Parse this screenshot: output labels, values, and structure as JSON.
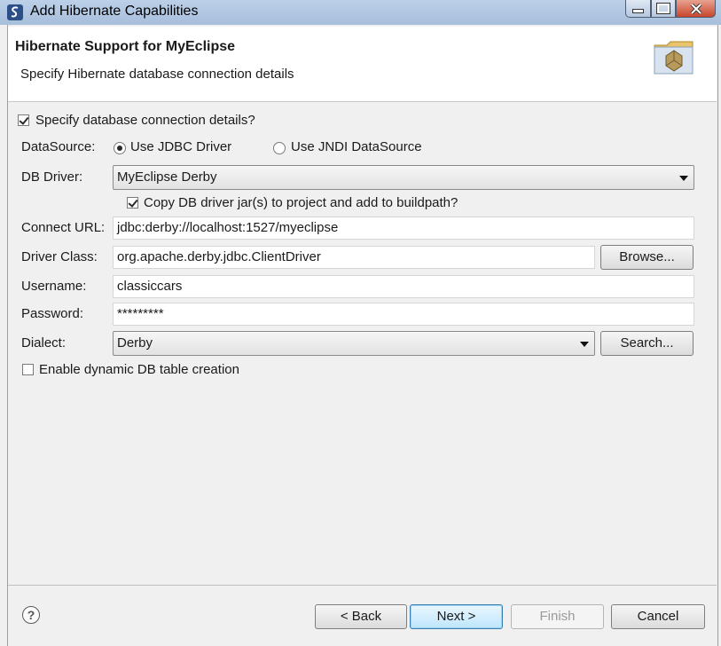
{
  "window": {
    "title": "Add Hibernate Capabilities"
  },
  "header": {
    "title": "Hibernate Support for MyEclipse",
    "subtitle": "Specify Hibernate database connection details",
    "icon": "hibernate-wizard-icon"
  },
  "form": {
    "specify_details": {
      "label": "Specify database connection details?",
      "checked": true
    },
    "datasource": {
      "label": "DataSource:",
      "options": [
        "Use JDBC Driver",
        "Use JNDI DataSource"
      ],
      "selected": "Use JDBC Driver"
    },
    "db_driver": {
      "label": "DB Driver:",
      "value": "MyEclipse Derby"
    },
    "copy_jars": {
      "label": "Copy DB driver jar(s) to project and add to buildpath?",
      "checked": true
    },
    "connect_url": {
      "label": "Connect URL:",
      "value": "jdbc:derby://localhost:1527/myeclipse"
    },
    "driver_class": {
      "label": "Driver Class:",
      "value": "org.apache.derby.jdbc.ClientDriver",
      "browse_label": "Browse..."
    },
    "username": {
      "label": "Username:",
      "value": "classiccars"
    },
    "password": {
      "label": "Password:",
      "value": "*********"
    },
    "dialect": {
      "label": "Dialect:",
      "value": "Derby",
      "search_label": "Search..."
    },
    "dynamic_table": {
      "label": "Enable dynamic DB table creation",
      "checked": false
    }
  },
  "footer": {
    "help_label": "?",
    "back_label": "< Back",
    "next_label": "Next >",
    "finish_label": "Finish",
    "cancel_label": "Cancel"
  }
}
